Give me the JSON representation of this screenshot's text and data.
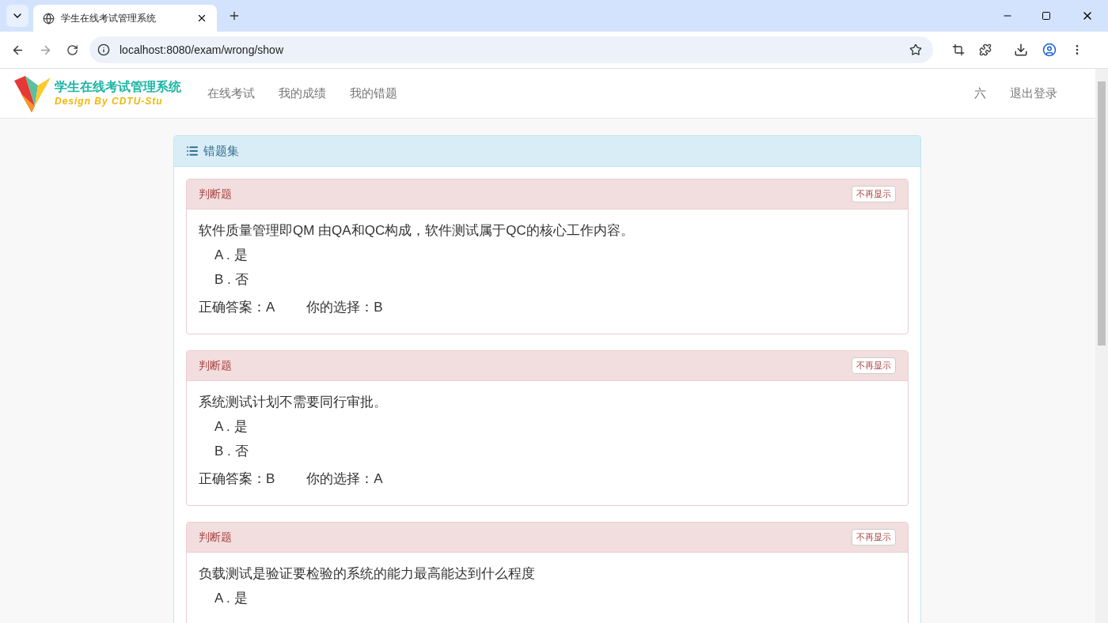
{
  "browser": {
    "tab_title": "学生在线考试管理系统",
    "url": "localhost:8080/exam/wrong/show"
  },
  "navbar": {
    "brand_title": "学生在线考试管理系统",
    "brand_subtitle": "Design By CDTU-Stu",
    "links": [
      "在线考试",
      "我的成绩",
      "我的错题"
    ],
    "user": "六",
    "logout": "退出登录"
  },
  "panel": {
    "title": "错题集"
  },
  "questions": [
    {
      "type": "判断题",
      "hide_button": "不再显示",
      "text": "软件质量管理即QM 由QA和QC构成，软件测试属于QC的核心工作内容。",
      "options": [
        "A . 是",
        "B . 否"
      ],
      "correct": "正确答案：A",
      "choice": "你的选择：B"
    },
    {
      "type": "判断题",
      "hide_button": "不再显示",
      "text": "系统测试计划不需要同行审批。",
      "options": [
        "A . 是",
        "B . 否"
      ],
      "correct": "正确答案：B",
      "choice": "你的选择：A"
    },
    {
      "type": "判断题",
      "hide_button": "不再显示",
      "text": "负载测试是验证要检验的系统的能力最高能达到什么程度",
      "options": [
        "A . 是"
      ]
    }
  ]
}
